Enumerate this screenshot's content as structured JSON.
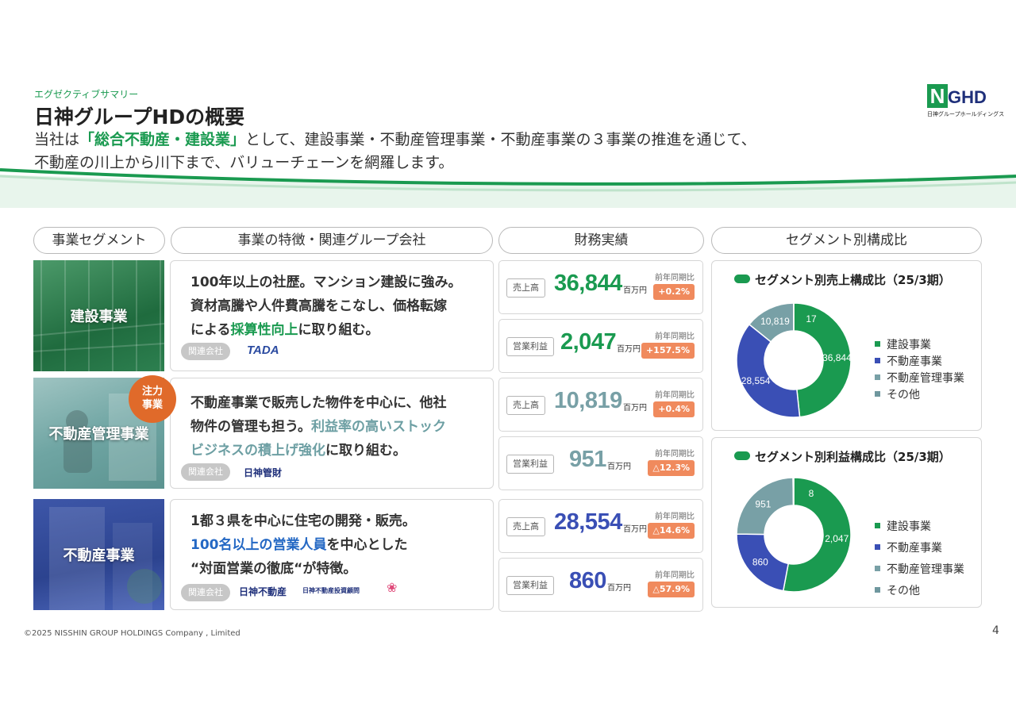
{
  "header": {
    "eyebrow": "エグゼクティブサマリー",
    "title": "日神グループHDの概要",
    "lead_1": "当社は",
    "lead_hl": "「総合不動産・建設業」",
    "lead_2": "として、建設事業・不動産管理事業・不動産事業の３事業の推進を通じて、",
    "lead_3": "不動産の川上から川下まで、バリューチェーンを網羅します。"
  },
  "logo": {
    "n": "N",
    "rest": "GHD",
    "sub": "日神グループホールディングス"
  },
  "columns": [
    "事業セグメント",
    "事業の特徴・関連グループ会社",
    "財務実績",
    "セグメント別構成比"
  ],
  "focus_badge": {
    "line1": "注力",
    "line2": "事業"
  },
  "related_label": "関連会社",
  "segments": [
    {
      "name": "建設事業",
      "lines": [
        [
          {
            "t": "100年以上の社歴。マンション建設に強み。"
          }
        ],
        [
          {
            "t": "資材高騰や人件費高騰をこなし、価格転嫁"
          }
        ],
        [
          {
            "t": "による"
          },
          {
            "t": "採算性向上",
            "c": "g"
          },
          {
            "t": "に取り組む。"
          }
        ]
      ],
      "companies": [
        "TADA"
      ],
      "sales": {
        "kind": "売上高",
        "value": "36,844",
        "unit": "百万円",
        "yoy_label": "前年同期比",
        "yoy": "+0.2%"
      },
      "profit": {
        "kind": "営業利益",
        "value": "2,047",
        "unit": "百万円",
        "yoy_label": "前年同期比",
        "yoy": "+157.5%"
      }
    },
    {
      "name": "不動産管理事業",
      "lines": [
        [
          {
            "t": "不動産事業で販売した物件を中心に、他社"
          }
        ],
        [
          {
            "t": "物件の管理も担う。"
          },
          {
            "t": "利益率の高いストック",
            "c": "t"
          }
        ],
        [
          {
            "t": "ビジネスの積上げ強化",
            "c": "t"
          },
          {
            "t": "に取り組む。"
          }
        ]
      ],
      "companies": [
        "日神管財"
      ],
      "sales": {
        "kind": "売上高",
        "value": "10,819",
        "unit": "百万円",
        "yoy_label": "前年同期比",
        "yoy": "+0.4%"
      },
      "profit": {
        "kind": "営業利益",
        "value": "951",
        "unit": "百万円",
        "yoy_label": "前年同期比",
        "yoy": "△12.3%"
      }
    },
    {
      "name": "不動産事業",
      "lines": [
        [
          {
            "t": "1都３県を中心に住宅の開発・販売。"
          }
        ],
        [
          {
            "t": "100名以上の営業人員",
            "c": "b"
          },
          {
            "t": "を中心とした"
          }
        ],
        [
          {
            "t": "“対面営業の徹底“が特徴。"
          }
        ]
      ],
      "companies": [
        "日神不動産",
        "日神不動産投資顧問"
      ],
      "sales": {
        "kind": "売上高",
        "value": "28,554",
        "unit": "百万円",
        "yoy_label": "前年同期比",
        "yoy": "△14.6%"
      },
      "profit": {
        "kind": "営業利益",
        "value": "860",
        "unit": "百万円",
        "yoy_label": "前年同期比",
        "yoy": "△57.9%"
      }
    }
  ],
  "chart_data": [
    {
      "type": "pie",
      "title": "セグメント別売上構成比（25/3期）",
      "categories": [
        "建設事業",
        "不動産事業",
        "不動産管理事業",
        "その他"
      ],
      "values": [
        36844,
        28554,
        10819,
        17
      ],
      "labels": [
        "36,844",
        "28,554",
        "10,819",
        "17"
      ],
      "colors": [
        "#1a9a50",
        "#3a4fb5",
        "#78a0a6",
        "#6f979e"
      ],
      "legend": "right"
    },
    {
      "type": "pie",
      "title": "セグメント別利益構成比（25/3期）",
      "categories": [
        "建設事業",
        "不動産事業",
        "不動産管理事業",
        "その他"
      ],
      "values": [
        2047,
        860,
        951,
        8
      ],
      "labels": [
        "2,047",
        "860",
        "951",
        "8"
      ],
      "colors": [
        "#1a9a50",
        "#3a4fb5",
        "#78a0a6",
        "#6f979e"
      ],
      "legend": "right"
    }
  ],
  "footer": "©2025 NISSHIN GROUP HOLDINGS Company , Limited",
  "page_number": "4"
}
